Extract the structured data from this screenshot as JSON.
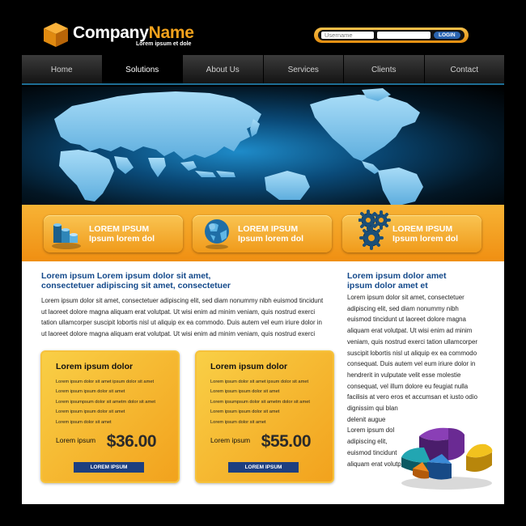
{
  "header": {
    "brand_company": "Company",
    "brand_name": "Name",
    "tagline": "Lorem ipsum et dole",
    "login": {
      "username_placeholder": "Username",
      "password_value": "",
      "button_label": "LOGIN"
    }
  },
  "nav": {
    "items": [
      "Home",
      "Solutions",
      "About Us",
      "Services",
      "Clients",
      "Contact"
    ],
    "active": "Solutions"
  },
  "features": [
    {
      "line1": "LOREM IPSUM",
      "line2": "Ipsum lorem dol",
      "icon": "bar-chart-icon"
    },
    {
      "line1": "LOREM IPSUM",
      "line2": "Ipsum lorem dol",
      "icon": "globe-icon"
    },
    {
      "line1": "LOREM IPSUM",
      "line2": "Ipsum lorem dol",
      "icon": "gears-icon"
    }
  ],
  "main": {
    "heading_line1": "Lorem ipsum Lorem ipsum dolor sit amet,",
    "heading_line2": "consectetuer adipiscing sit amet,  consectetuer",
    "para_lines": [
      "Lorem ipsum dolor sit amet, consectetuer adipiscing elit, sed diam nonummy nibh euismod tincidunt",
      "ut laoreet dolore magna aliquam erat volutpat. Ut wisi enim ad minim veniam, quis nostrud exerci",
      "tation ullamcorper suscipit lobortis nisl ut aliquip ex ea commodo.  Duis autem vel eum iriure dolor in",
      "ut laoreet dolore magna aliquam erat volutpat. Ut wisi enim ad minim veniam, quis nostrud exerci"
    ]
  },
  "pricing": [
    {
      "title": "Lorem ipsum dolor",
      "items": [
        "Lorem ipsum dolor sit amet ipsum dolor sit amet",
        "Lorem ipsum ipsum dolor sit amet",
        "Lorem ipsumpsum dolor sit ametm dolor sit amet",
        "Lorem ipsum ipsum dolor sit amet",
        "Lorem ipsum dolor sit amet"
      ],
      "price_label": "Lorem ipsum",
      "price": "$36.00",
      "button": "LOREM IPSUM"
    },
    {
      "title": "Lorem ipsum dolor",
      "items": [
        "Lorem ipsum dolor sit amet ipsum dolor sit amet",
        "Lorem ipsum ipsum dolor sit amet",
        "Lorem ipsumpsum dolor sit ametm dolor sit amet",
        "Lorem ipsum ipsum dolor sit amet",
        "Lorem ipsum dolor sit amet"
      ],
      "price_label": "Lorem ipsum",
      "price": "$55.00",
      "button": "LOREM IPSUM"
    }
  ],
  "sidebar": {
    "heading_line1": "Lorem ipsum dolor amet",
    "heading_line2": "ipsum dolor amet et",
    "para_lines": [
      "Lorem ipsum dolor sit amet, consectetuer",
      "adipiscing elit, sed diam nonummy nibh",
      "euismod tincidunt ut laoreet dolore magna",
      "aliquam erat volutpat. Ut wisi enim ad minim",
      "veniam, quis nostrud exerci tation ullamcorper",
      "suscipit lobortis nisl ut aliquip ex ea commodo",
      "consequat.  Duis autem vel eum iriure dolor in",
      "hendrerit in vulputate velit esse molestie",
      "consequat, vel illum dolore eu feugiat nulla",
      "facilisis at vero eros et accumsan et iusto odio",
      "dignissim qui blan",
      "delenit augue",
      "Lorem ipsum dol",
      "adipiscing elit,",
      "euismod tincidunt",
      "aliquam erat volutpat."
    ]
  },
  "colors": {
    "accent": "#f3a21c",
    "heading_blue": "#12488a",
    "button_navy": "#1d3f80"
  }
}
